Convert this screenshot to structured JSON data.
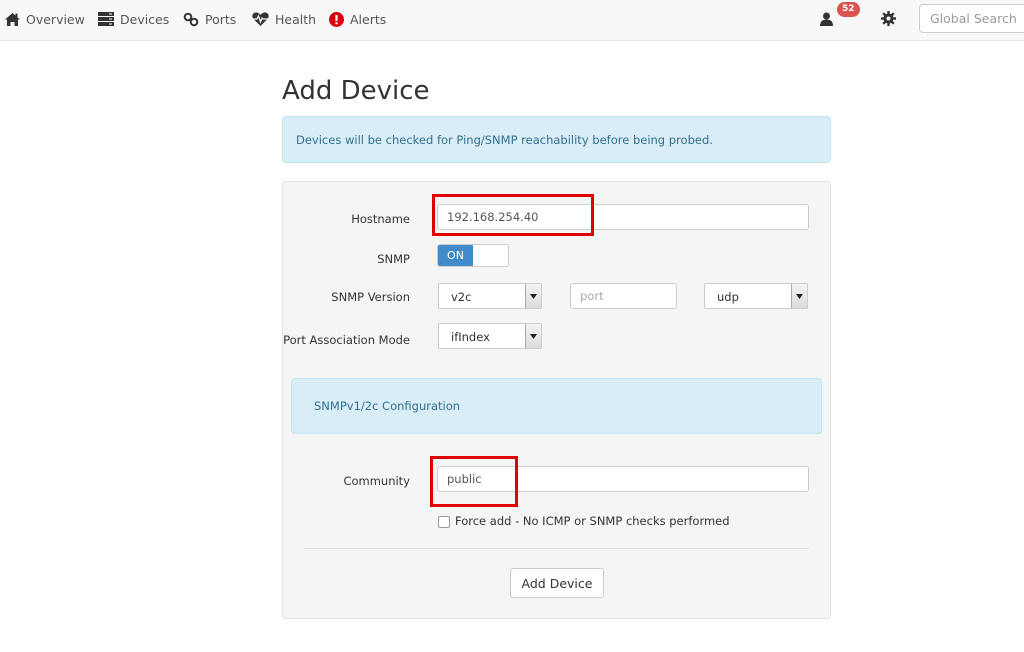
{
  "nav": {
    "items": [
      {
        "label": "Overview",
        "icon": "home-icon"
      },
      {
        "label": "Devices",
        "icon": "server-icon"
      },
      {
        "label": "Ports",
        "icon": "link-icon"
      },
      {
        "label": "Health",
        "icon": "heartbeat-icon"
      },
      {
        "label": "Alerts",
        "icon": "exclamation-circle-icon"
      }
    ],
    "user_badge": "52",
    "search_placeholder": "Global Search"
  },
  "page": {
    "title": "Add Device",
    "info_text": "Devices will be checked for Ping/SNMP reachability before being probed."
  },
  "form": {
    "hostname_label": "Hostname",
    "hostname_value": "192.168.254.40",
    "snmp_label": "SNMP",
    "snmp_toggle": "ON",
    "snmp_version_label": "SNMP Version",
    "snmp_version_value": "v2c",
    "port_placeholder": "port",
    "transport_value": "udp",
    "port_assoc_label": "Port Association Mode",
    "port_assoc_value": "ifIndex",
    "snmp_config_title": "SNMPv1/2c Configuration",
    "community_label": "Community",
    "community_value": "public",
    "force_add_label": "Force add - No ICMP or SNMP checks performed",
    "submit_label": "Add Device"
  },
  "colors": {
    "accent": "#428bca",
    "info_bg": "#d9edf7",
    "info_text": "#31708f",
    "badge": "#d9534f",
    "highlight": "#e00000",
    "alert_icon": "#d9000d"
  }
}
